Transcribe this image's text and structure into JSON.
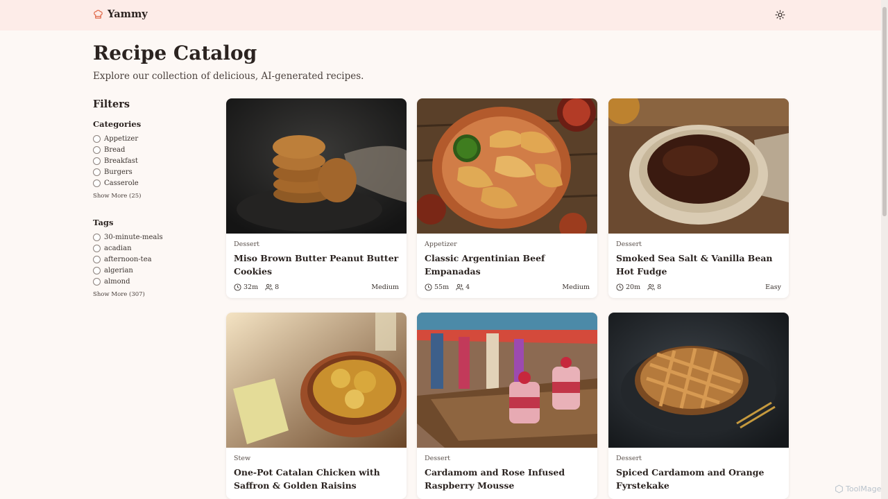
{
  "header": {
    "brand": "Yammy",
    "brand_color": "#e0694a"
  },
  "page": {
    "title": "Recipe Catalog",
    "subtitle": "Explore our collection of delicious, AI-generated recipes."
  },
  "filters": {
    "title": "Filters",
    "categories": {
      "title": "Categories",
      "items": [
        "Appetizer",
        "Bread",
        "Breakfast",
        "Burgers",
        "Casserole"
      ],
      "show_more": "Show More (25)"
    },
    "tags": {
      "title": "Tags",
      "items": [
        "30-minute-meals",
        "acadian",
        "afternoon-tea",
        "algerian",
        "almond"
      ],
      "show_more": "Show More (307)"
    }
  },
  "recipes": [
    {
      "category": "Dessert",
      "title": "Miso Brown Butter Peanut Butter Cookies",
      "time": "32m",
      "servings": "8",
      "difficulty": "Medium"
    },
    {
      "category": "Appetizer",
      "title": "Classic Argentinian Beef Empanadas",
      "time": "55m",
      "servings": "4",
      "difficulty": "Medium"
    },
    {
      "category": "Dessert",
      "title": "Smoked Sea Salt & Vanilla Bean Hot Fudge",
      "time": "20m",
      "servings": "8",
      "difficulty": "Easy"
    },
    {
      "category": "Stew",
      "title": "One-Pot Catalan Chicken with Saffron & Golden Raisins"
    },
    {
      "category": "Dessert",
      "title": "Cardamom and Rose Infused Raspberry Mousse"
    },
    {
      "category": "Dessert",
      "title": "Spiced Cardamom and Orange Fyrstekake"
    }
  ],
  "watermark": "ToolMage"
}
